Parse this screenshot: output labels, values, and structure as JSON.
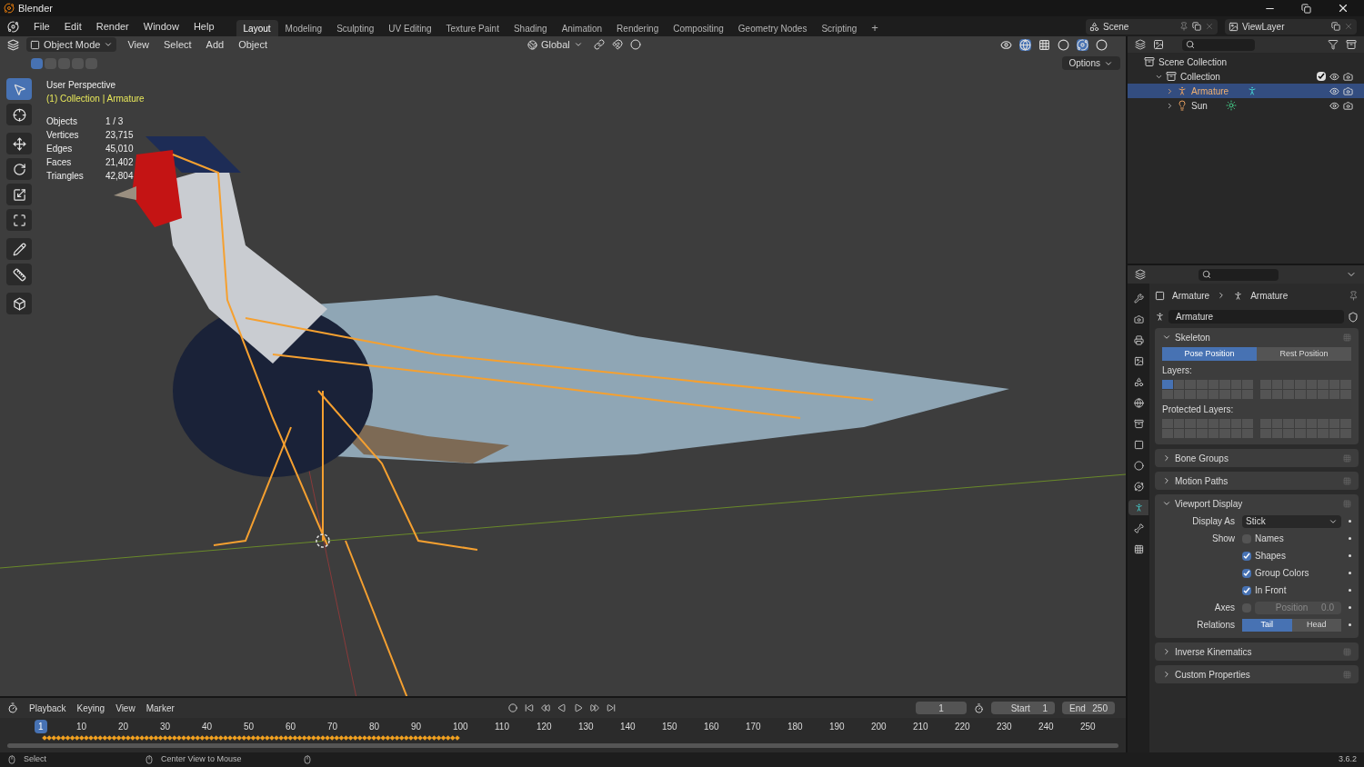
{
  "window": {
    "title": "Blender"
  },
  "menus": [
    "File",
    "Edit",
    "Render",
    "Window",
    "Help"
  ],
  "workspaces": [
    {
      "label": "Layout",
      "selected": true
    },
    {
      "label": "Modeling",
      "selected": false
    },
    {
      "label": "Sculpting",
      "selected": false
    },
    {
      "label": "UV Editing",
      "selected": false
    },
    {
      "label": "Texture Paint",
      "selected": false
    },
    {
      "label": "Shading",
      "selected": false
    },
    {
      "label": "Animation",
      "selected": false
    },
    {
      "label": "Rendering",
      "selected": false
    },
    {
      "label": "Compositing",
      "selected": false
    },
    {
      "label": "Geometry Nodes",
      "selected": false
    },
    {
      "label": "Scripting",
      "selected": false
    }
  ],
  "add_workspace": "+",
  "scene": "Scene",
  "view_layer": "ViewLayer",
  "viewport": {
    "mode": "Object Mode",
    "menus": [
      "View",
      "Select",
      "Add",
      "Object"
    ],
    "orientation": "Global",
    "options": "Options",
    "select_modes": [
      {
        "selected": true
      },
      {
        "selected": false
      },
      {
        "selected": false
      },
      {
        "selected": false
      },
      {
        "selected": false
      }
    ],
    "tools": [
      {
        "selected": true
      },
      {
        "selected": false
      },
      {
        "selected": false
      },
      {
        "selected": false
      },
      {
        "selected": false
      },
      {
        "selected": false
      },
      {
        "selected": false
      },
      {
        "selected": false
      },
      {
        "selected": false
      }
    ],
    "view_name": "User Perspective",
    "context": "(1) Collection | Armature",
    "stats": [
      {
        "label": "Objects",
        "value": "1 / 3"
      },
      {
        "label": "Vertices",
        "value": "23,715"
      },
      {
        "label": "Edges",
        "value": "45,010"
      },
      {
        "label": "Faces",
        "value": "21,402"
      },
      {
        "label": "Triangles",
        "value": "42,804"
      }
    ]
  },
  "outliner": {
    "items": [
      {
        "label": "Scene Collection",
        "kind": "scene",
        "selected": false,
        "children": [
          {
            "label": "Collection",
            "kind": "collection",
            "selected": false,
            "checked": true,
            "expanded": true,
            "children": [
              {
                "label": "Armature",
                "kind": "armature",
                "selected": true,
                "expanded": false
              },
              {
                "label": "Sun",
                "kind": "light",
                "selected": false,
                "expanded": false
              }
            ]
          }
        ]
      }
    ]
  },
  "properties": {
    "tabs": [
      {
        "selected": false
      },
      {
        "selected": false
      },
      {
        "selected": false
      },
      {
        "selected": false
      },
      {
        "selected": false
      },
      {
        "selected": false
      },
      {
        "selected": false
      },
      {
        "selected": false
      },
      {
        "selected": false
      },
      {
        "selected": false
      },
      {
        "selected": true
      },
      {
        "selected": false
      },
      {
        "selected": false
      }
    ],
    "breadcrumb": [
      "Armature",
      "Armature"
    ],
    "data_name": "Armature",
    "panels": [
      {
        "kind": "skeleton",
        "title": "Skeleton",
        "expanded": true,
        "positions": [
          {
            "label": "Pose Position",
            "selected": true
          },
          {
            "label": "Rest Position",
            "selected": false
          }
        ],
        "layers_label": "Layers:",
        "layers_on": [
          true,
          false,
          false,
          false,
          false,
          false,
          false,
          false,
          false,
          false,
          false,
          false,
          false,
          false,
          false,
          false,
          false,
          false,
          false,
          false,
          false,
          false,
          false,
          false,
          false,
          false,
          false,
          false,
          false,
          false,
          false,
          false
        ],
        "protected_label": "Protected Layers:"
      },
      {
        "kind": "plain",
        "title": "Bone Groups",
        "expanded": false
      },
      {
        "kind": "plain",
        "title": "Motion Paths",
        "expanded": false
      },
      {
        "kind": "display",
        "title": "Viewport Display",
        "expanded": true,
        "display_as_label": "Display As",
        "display_as": "Stick",
        "show_label": "Show",
        "show": [
          {
            "label": "Names",
            "checked": false
          },
          {
            "label": "Shapes",
            "checked": true
          },
          {
            "label": "Group Colors",
            "checked": true
          },
          {
            "label": "In Front",
            "checked": true
          }
        ],
        "axes_label": "Axes",
        "axes_checked": false,
        "axes_position": "Position",
        "axes_value": "0.0",
        "relations_label": "Relations",
        "relations": [
          {
            "label": "Tail",
            "selected": true
          },
          {
            "label": "Head",
            "selected": false
          }
        ]
      },
      {
        "kind": "plain",
        "title": "Inverse Kinematics",
        "expanded": false
      },
      {
        "kind": "plain",
        "title": "Custom Properties",
        "expanded": false
      }
    ]
  },
  "timeline": {
    "menus": [
      "Playback",
      "Keying",
      "View",
      "Marker"
    ],
    "current_frame": "1",
    "start_label": "Start",
    "start": "1",
    "end_label": "End",
    "end": "250",
    "ruler": [
      {
        "label": "1",
        "selected": true
      },
      {
        "label": "10",
        "selected": false
      },
      {
        "label": "20",
        "selected": false
      },
      {
        "label": "30",
        "selected": false
      },
      {
        "label": "40",
        "selected": false
      },
      {
        "label": "50",
        "selected": false
      },
      {
        "label": "60",
        "selected": false
      },
      {
        "label": "70",
        "selected": false
      },
      {
        "label": "80",
        "selected": false
      },
      {
        "label": "90",
        "selected": false
      },
      {
        "label": "100",
        "selected": false
      },
      {
        "label": "110",
        "selected": false
      },
      {
        "label": "120",
        "selected": false
      },
      {
        "label": "130",
        "selected": false
      },
      {
        "label": "140",
        "selected": false
      },
      {
        "label": "150",
        "selected": false
      },
      {
        "label": "160",
        "selected": false
      },
      {
        "label": "170",
        "selected": false
      },
      {
        "label": "180",
        "selected": false
      },
      {
        "label": "190",
        "selected": false
      },
      {
        "label": "200",
        "selected": false
      },
      {
        "label": "210",
        "selected": false
      },
      {
        "label": "220",
        "selected": false
      },
      {
        "label": "230",
        "selected": false
      },
      {
        "label": "240",
        "selected": false
      },
      {
        "label": "250",
        "selected": false
      }
    ]
  },
  "status_bar": {
    "items": [
      "Select",
      "Center View to Mouse"
    ],
    "version": "3.6.2"
  }
}
